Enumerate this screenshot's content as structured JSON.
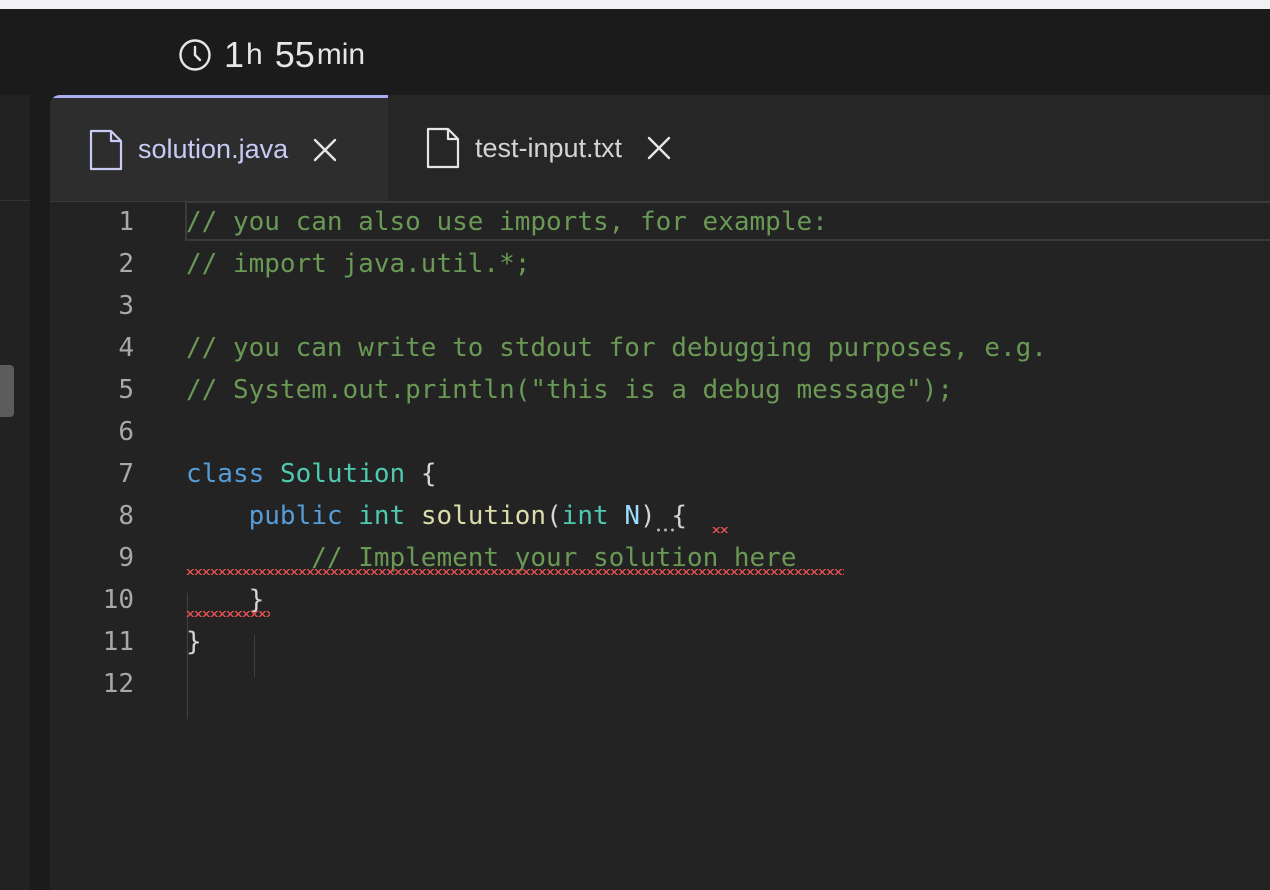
{
  "timer": {
    "hours": "1",
    "hours_unit": "h",
    "minutes": "55",
    "minutes_unit": "min"
  },
  "tabs": [
    {
      "label": "solution.java",
      "active": true
    },
    {
      "label": "test-input.txt",
      "active": false
    }
  ],
  "code": {
    "line_numbers": [
      "1",
      "2",
      "3",
      "4",
      "5",
      "6",
      "7",
      "8",
      "9",
      "10",
      "11",
      "12"
    ],
    "l1": "// you can also use imports, for example:",
    "l2": "// import java.util.*;",
    "l4": "// you can write to stdout for debugging purposes, e.g.",
    "l5": "// System.out.println(\"this is a debug message\");",
    "l7_kw": "class",
    "l7_type": "Solution",
    "l7_brace": "{",
    "l8_kw": "public",
    "l8_type": "int",
    "l8_fn": "solution",
    "l8_open": "(",
    "l8_ptype": "int",
    "l8_param": "N",
    "l8_close": ")",
    "l8_brace": "{",
    "l9": "// Implement your solution here",
    "l10": "}",
    "l11": "}"
  },
  "colors": {
    "accent_tab": "#a9aef3",
    "comment": "#6a9955",
    "keyword": "#569cd6",
    "type": "#4ec9b0",
    "function": "#dcdcaa",
    "error_squiggle": "#e05050"
  }
}
